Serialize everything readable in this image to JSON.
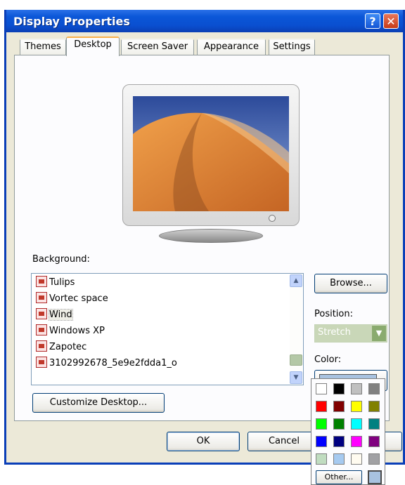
{
  "window": {
    "title": "Display Properties",
    "help_glyph": "?",
    "close_glyph": "✕"
  },
  "tabs": [
    {
      "label": "Themes"
    },
    {
      "label": "Desktop"
    },
    {
      "label": "Screen Saver"
    },
    {
      "label": "Appearance"
    },
    {
      "label": "Settings"
    }
  ],
  "background": {
    "label": "Background:",
    "items": [
      {
        "label": "Tulips"
      },
      {
        "label": "Vortec space"
      },
      {
        "label": "Wind"
      },
      {
        "label": "Windows XP"
      },
      {
        "label": "Zapotec"
      },
      {
        "label": "3102992678_5e9e2fdda1_o"
      }
    ],
    "selected": "Wind"
  },
  "browse_label": "Browse...",
  "position": {
    "label": "Position:",
    "value": "Stretch"
  },
  "color": {
    "label": "Color:",
    "value": "#a8c2e0"
  },
  "customize_label": "Customize Desktop...",
  "ok_label": "OK",
  "cancel_label": "Cancel",
  "palette": {
    "colors": [
      "#ffffff",
      "#000000",
      "#c0c0c0",
      "#808080",
      "#ff0000",
      "#800000",
      "#ffff00",
      "#808000",
      "#00ff00",
      "#008000",
      "#00ffff",
      "#008080",
      "#0000ff",
      "#000080",
      "#ff00ff",
      "#800080",
      "#c0dcc0",
      "#a6caf0",
      "#fffbf0",
      "#a0a0a4"
    ],
    "other_label": "Other..."
  }
}
